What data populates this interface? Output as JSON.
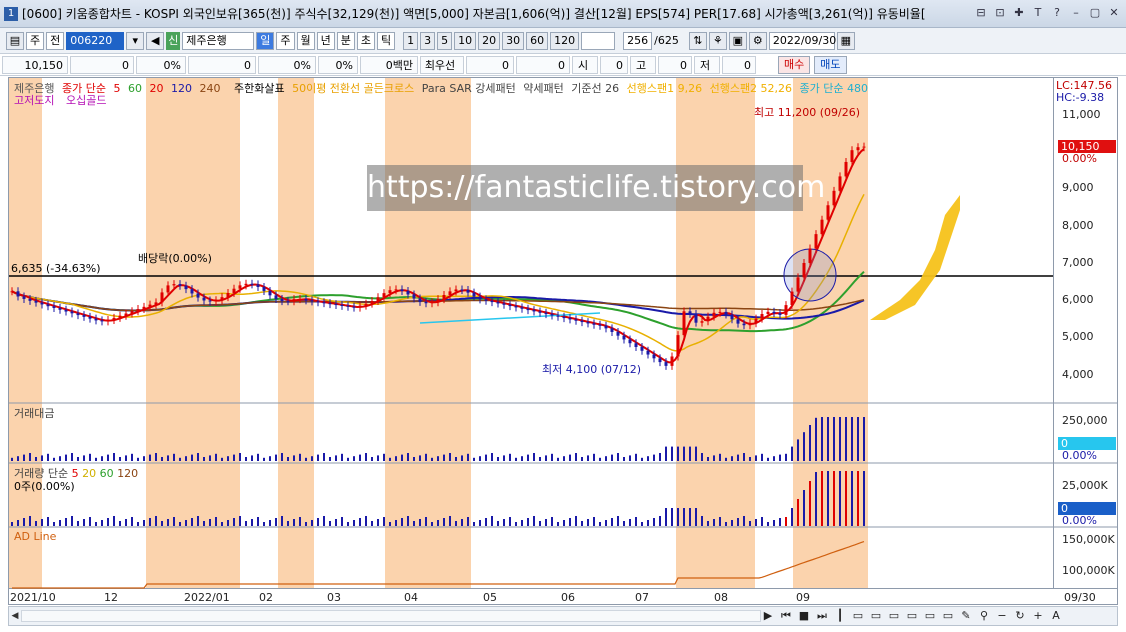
{
  "window": {
    "app_number": "1",
    "title": "[0600] 키움종합차트 - KOSPI 외국인보유[365(천)] 주식수[32,129(천)] 액면[5,000] 자본금[1,606(억)] 결산[12월] EPS[574] PER[17.68] 시가총액[3,261(억)] 유동비율[",
    "buttons": [
      "⊟",
      "⊡",
      "✚",
      "T",
      "?",
      "–",
      "▢",
      "✕"
    ]
  },
  "toolbar": {
    "type1": "주",
    "type2": "전",
    "code": "006220",
    "market_tag": "신",
    "stock_name": "제주은행",
    "periods": [
      "일",
      "주",
      "월",
      "년",
      "분",
      "초",
      "틱"
    ],
    "active_period": "일",
    "intervals": [
      "1",
      "3",
      "5",
      "10",
      "20",
      "30",
      "60",
      "120"
    ],
    "bar_count": "256",
    "bar_total": "/625",
    "date": "2022/09/30"
  },
  "quote": {
    "price": "10,150",
    "change": "0",
    "change_pct": "0%",
    "volume": "0",
    "volume_pct": "0%",
    "extra_pct": "0%",
    "amount": "0백만",
    "prior_label": "최우선",
    "prior1": "0",
    "prior2": "0",
    "open_label": "시",
    "open": "0",
    "high_label": "고",
    "high": "0",
    "low_label": "저",
    "low": "0",
    "buy": "매수",
    "sell": "매도"
  },
  "legend": {
    "stock": "제주은행",
    "ma_label": "종가 단순",
    "ma_values": [
      "5",
      "60",
      "20",
      "120",
      "240"
    ],
    "ma_colors": [
      "#e00000",
      "#2da02d",
      "#e00000",
      "#1a1aa8",
      "#8b4513"
    ],
    "item2": "주한화살표",
    "item3": "50이평 전환선 골든크로스",
    "item4": "Para SAR 강세패턴",
    "item5": "약세패턴",
    "item6": "기준선 26",
    "item7": "선행스팬1 9,26",
    "item8": "선행스팬2 52,26",
    "item9": "종가 단순 480",
    "line2a": "고저도지",
    "line2b": "오십골드"
  },
  "price_axis": {
    "lc": "LC:147.56",
    "hc": "HC:-9.38",
    "ticks": [
      "11,000",
      "10,000",
      "9,000",
      "8,000",
      "7,000",
      "6,000",
      "5,000",
      "4,000"
    ],
    "current": "10,150",
    "current_pct": "0.00%"
  },
  "annotations": {
    "high": "최고 11,200 (09/26)",
    "low": "최저 4,100 (07/12)",
    "ref": "6,635 (-34.63%)",
    "dividend": "배당락(0.00%)"
  },
  "watermark": "https://fantasticlife.tistory.com",
  "panes": {
    "amount_title": "거래대금",
    "amount_ticks": [
      "250,000"
    ],
    "amount_val": "0",
    "amount_pct": "0.00%",
    "volume_title": "거래량 단순",
    "volume_ma": [
      "5",
      "20",
      "60",
      "120"
    ],
    "volume_sub": "0주(0.00%)",
    "volume_ticks": [
      "25,000K"
    ],
    "volume_val": "0",
    "volume_pct": "0.00%",
    "ad_title": "AD Line",
    "ad_ticks": [
      "150,000K",
      "100,000K"
    ]
  },
  "xaxis": [
    "2021/10",
    "12",
    "2022/01",
    "02",
    "03",
    "04",
    "05",
    "06",
    "07",
    "08",
    "09",
    "09/30"
  ],
  "colors": {
    "accent": "#1f63c7",
    "highlight_band": "#fbd3ad",
    "ichimoku_cloud": "#f6c21a",
    "up": "#e00000",
    "down": "#1a1aa8"
  }
}
